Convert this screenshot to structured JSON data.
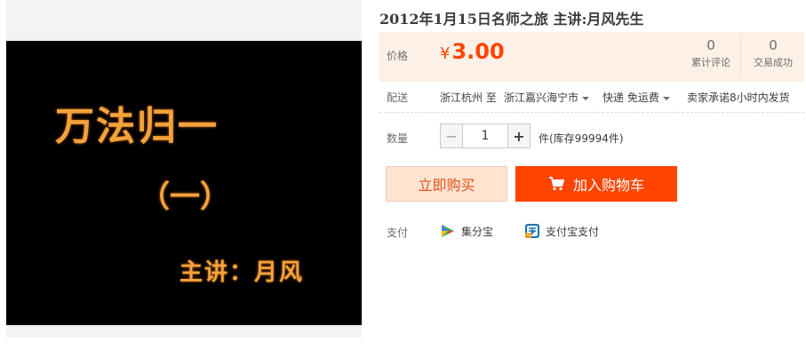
{
  "product": {
    "title": "2012年1月15日名师之旅 主讲:月风先生"
  },
  "video": {
    "title": "万法归一",
    "subtitle": "（一）",
    "speaker": "主讲：月风"
  },
  "price": {
    "label": "价格",
    "currency": "¥",
    "value": "3.00",
    "reviews_count": "0",
    "reviews_label": "累计评论",
    "sales_count": "0",
    "sales_label": "交易成功"
  },
  "shipping": {
    "label": "配送",
    "from": "浙江杭州 至",
    "to": "浙江嘉兴海宁市",
    "method": "快递 免运费",
    "promise": "卖家承诺8小时内发货"
  },
  "quantity": {
    "label": "数量",
    "minus": "−",
    "value": "1",
    "plus": "+",
    "stock": "件(库存99994件)"
  },
  "actions": {
    "buy_now": "立即购买",
    "add_to_cart": "加入购物车"
  },
  "payment": {
    "label": "支付",
    "option1": "集分宝",
    "option2": "支付宝支付"
  },
  "colors": {
    "accent": "#ff4400",
    "price": "#ff4400",
    "price_bg": "#fdf1e7",
    "buy_now_bg": "#ffe4d0"
  },
  "icons": {
    "cart": "cart-icon",
    "jifenbao": "jifenbao-icon",
    "alipay": "alipay-icon"
  }
}
